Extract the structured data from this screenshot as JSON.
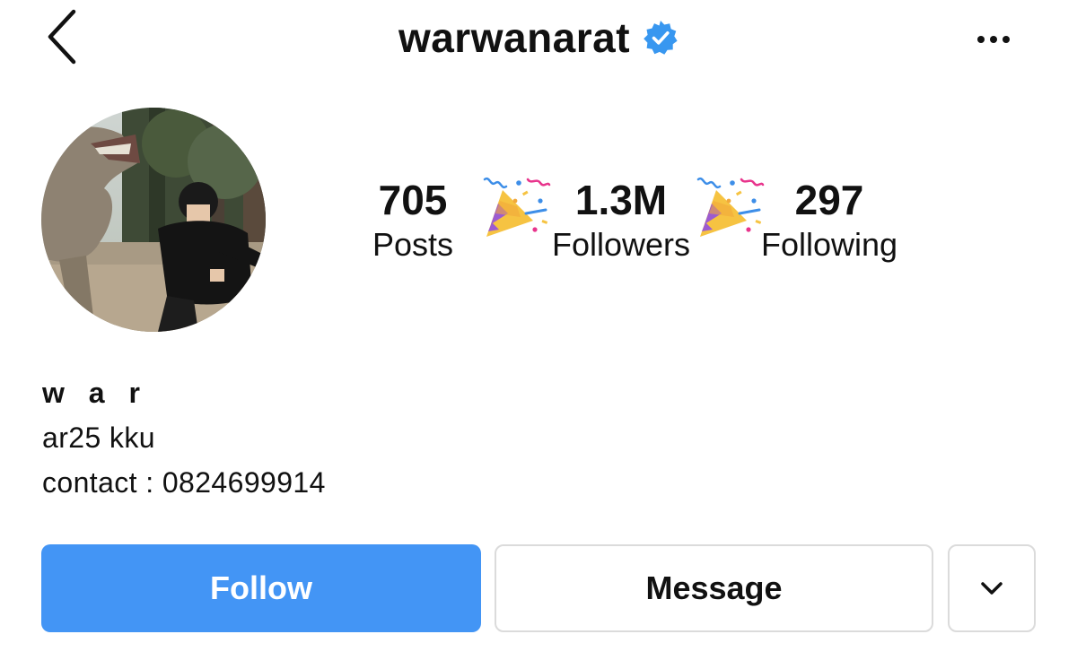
{
  "header": {
    "back_icon": "chevron-left-icon",
    "username": "warwanarat",
    "verified": true,
    "verified_color": "#3897f0",
    "more_icon": "more-horizontal-icon"
  },
  "profile": {
    "avatar": "profile-photo"
  },
  "stats": {
    "posts": {
      "value": "705",
      "label": "Posts"
    },
    "followers": {
      "value": "1.3M",
      "label": "Followers"
    },
    "following": {
      "value": "297",
      "label": "Following"
    },
    "separator_icon": "party-popper-icon"
  },
  "bio": {
    "display_name": "w a r",
    "lines": [
      "ar25 kku",
      "contact : 0824699914"
    ]
  },
  "actions": {
    "follow_label": "Follow",
    "message_label": "Message",
    "more_icon": "chevron-down-icon",
    "follow_color": "#4395f5",
    "border_color": "#dbdbdb"
  }
}
